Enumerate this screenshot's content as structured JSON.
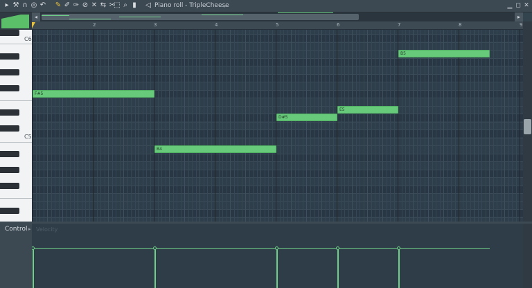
{
  "toolbar": {
    "title": "Piano roll - TripleCheese",
    "icons": [
      "arrow-down-icon",
      "wrench-icon",
      "magnet-icon",
      "stamp-icon",
      "undo-icon",
      "pencil-icon",
      "paint-brush-icon",
      "paint-brush-delete-icon",
      "delete-icon",
      "mute-icon",
      "slip-icon",
      "slice-icon",
      "select-icon",
      "zoom-icon",
      "playback-icon",
      "speaker-icon"
    ]
  },
  "window_buttons": [
    "minimize-icon",
    "maximize-icon",
    "close-icon"
  ],
  "ruler": {
    "bars": [
      "2",
      "3",
      "4",
      "5",
      "6",
      "7",
      "8",
      "9"
    ]
  },
  "keyboard": {
    "labels": [
      "C6",
      "C5"
    ]
  },
  "notes": [
    {
      "label": "F#5",
      "start_bar": 1.0,
      "length_bars": 2.0,
      "pitch": "F#5"
    },
    {
      "label": "B4",
      "start_bar": 3.0,
      "length_bars": 2.0,
      "pitch": "B4"
    },
    {
      "label": "D#5",
      "start_bar": 5.0,
      "length_bars": 1.0,
      "pitch": "D#5"
    },
    {
      "label": "E5",
      "start_bar": 6.0,
      "length_bars": 1.0,
      "pitch": "E5"
    },
    {
      "label": "B5",
      "start_bar": 7.0,
      "length_bars": 1.5,
      "pitch": "B5"
    }
  ],
  "event_editor": {
    "control_label": "Control",
    "target": "Velocity"
  },
  "colors": {
    "note": "#67c97a",
    "grid": "#2e3e4b",
    "accent": "#6fd187",
    "playhead": "#e7c13b"
  }
}
